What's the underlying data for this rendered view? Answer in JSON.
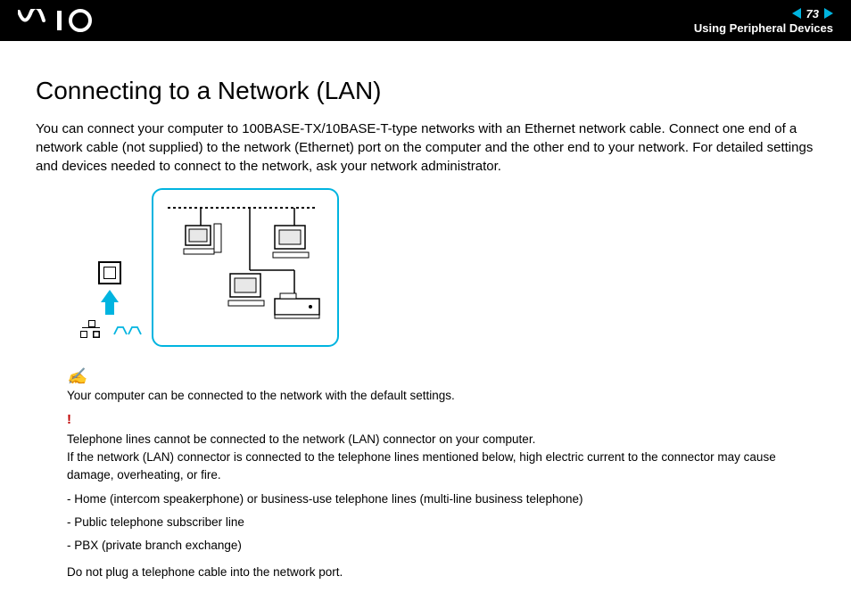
{
  "header": {
    "logo_alt": "VAIO",
    "page_number": "73",
    "section": "Using Peripheral Devices"
  },
  "title": "Connecting to a Network (LAN)",
  "intro": "You can connect your computer to 100BASE-TX/10BASE-T-type networks with an Ethernet network cable. Connect one end of a network cable (not supplied) to the network (Ethernet) port on the computer and the other end to your network. For detailed settings and devices needed to connect to the network, ask your network administrator.",
  "note_label": "✍",
  "note_text": "Your computer can be connected to the network with the default settings.",
  "warn_label": "!",
  "warn_text1": "Telephone lines cannot be connected to the network (LAN) connector on your computer.",
  "warn_text2": "If the network (LAN) connector is connected to the telephone lines mentioned below, high electric current to the connector may cause damage, overheating, or fire.",
  "bullets": [
    "- Home (intercom speakerphone) or business-use telephone lines (multi-line business telephone)",
    "- Public telephone subscriber line",
    "- PBX (private branch exchange)"
  ],
  "final": "Do not plug a telephone cable into the network port."
}
